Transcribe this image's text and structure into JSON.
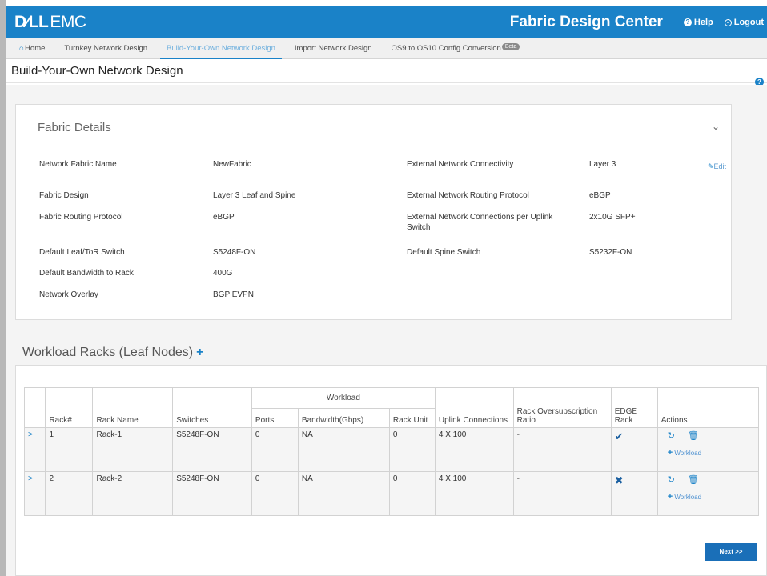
{
  "header": {
    "logo_dell": "D∕LL",
    "logo_emc": "EMC",
    "app_title": "Fabric Design Center",
    "help_label": "Help",
    "logout_label": "Logout"
  },
  "tabs": [
    {
      "label": "Home",
      "icon": "home-icon"
    },
    {
      "label": "Turnkey Network Design"
    },
    {
      "label": "Build-Your-Own Network Design",
      "active": true
    },
    {
      "label": "Import Network Design"
    },
    {
      "label": "OS9 to OS10 Config Conversion",
      "badge": "Beta"
    }
  ],
  "page": {
    "title": "Build-Your-Own Network Design"
  },
  "fabric_details": {
    "title": "Fabric Details",
    "edit_label": "Edit",
    "left": [
      {
        "label": "Network Fabric Name",
        "value": "NewFabric"
      },
      {
        "label": "Fabric Design",
        "value": "Layer 3 Leaf and Spine"
      },
      {
        "label": "Fabric Routing Protocol",
        "value": "eBGP"
      },
      {
        "label": "Default Leaf/ToR Switch",
        "value": "S5248F-ON"
      },
      {
        "label": "Default Bandwidth to Rack",
        "value": "400G"
      },
      {
        "label": "Network Overlay",
        "value": "BGP EVPN"
      }
    ],
    "right": [
      {
        "label": "External Network Connectivity",
        "value": "Layer 3"
      },
      {
        "label": "External Network Routing Protocol",
        "value": "eBGP"
      },
      {
        "label": "External Network Connections per Uplink Switch",
        "value": "2x10G SFP+"
      },
      {
        "label": "Default Spine Switch",
        "value": "S5232F-ON"
      }
    ]
  },
  "workload_racks": {
    "title": "Workload Racks (Leaf Nodes)",
    "headers": {
      "rack_num": "Rack#",
      "rack_name": "Rack Name",
      "switches": "Switches",
      "workload": "Workload",
      "ports": "Ports",
      "bandwidth": "Bandwidth(Gbps)",
      "rack_unit": "Rack Unit",
      "uplink": "Uplink Connections",
      "oversub": "Rack Oversubscription Ratio",
      "edge": "EDGE Rack",
      "actions": "Actions"
    },
    "add_workload_label": "Workload",
    "rows": [
      {
        "rack_num": "1",
        "rack_name": "Rack-1",
        "switches": "S5248F-ON",
        "ports": "0",
        "bandwidth": "NA",
        "rack_unit": "0",
        "uplink": "4 X 100",
        "oversub": "-",
        "edge": true
      },
      {
        "rack_num": "2",
        "rack_name": "Rack-2",
        "switches": "S5248F-ON",
        "ports": "0",
        "bandwidth": "NA",
        "rack_unit": "0",
        "uplink": "4 X 100",
        "oversub": "-",
        "edge": false
      }
    ]
  },
  "next_label": "Next >>"
}
